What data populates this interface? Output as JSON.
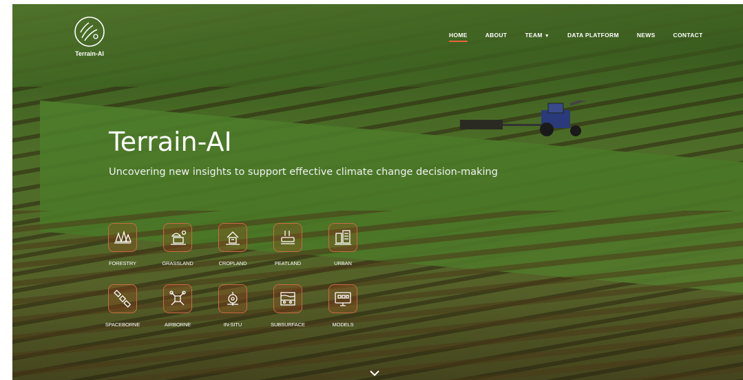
{
  "brand": {
    "logo_text": "Terrain-AI"
  },
  "nav": {
    "items": [
      {
        "label": "HOME",
        "active": true
      },
      {
        "label": "ABOUT",
        "active": false
      },
      {
        "label": "TEAM",
        "active": false,
        "has_dropdown": true
      },
      {
        "label": "DATA PLATFORM",
        "active": false
      },
      {
        "label": "NEWS",
        "active": false
      },
      {
        "label": "CONTACT",
        "active": false
      }
    ]
  },
  "hero": {
    "title": "Terrain-AI",
    "subtitle": "Uncovering new insights to support effective climate change decision-making"
  },
  "categories": {
    "row1": [
      {
        "label": "FORESTRY",
        "icon": "forest-icon"
      },
      {
        "label": "GRASSLAND",
        "icon": "grassland-icon"
      },
      {
        "label": "CROPLAND",
        "icon": "cropland-icon"
      },
      {
        "label": "PEATLAND",
        "icon": "peatland-icon"
      },
      {
        "label": "URBAN",
        "icon": "urban-icon"
      }
    ],
    "row2": [
      {
        "label": "SPACEBORNE",
        "icon": "satellite-icon"
      },
      {
        "label": "AIRBORNE",
        "icon": "drone-icon"
      },
      {
        "label": "IN-SITU",
        "icon": "sensor-icon"
      },
      {
        "label": "SUBSURFACE",
        "icon": "soil-layers-icon"
      },
      {
        "label": "MODELS",
        "icon": "monitor-model-icon"
      }
    ]
  },
  "colors": {
    "accent": "#e8643a",
    "icon_border": "#c96c43"
  }
}
